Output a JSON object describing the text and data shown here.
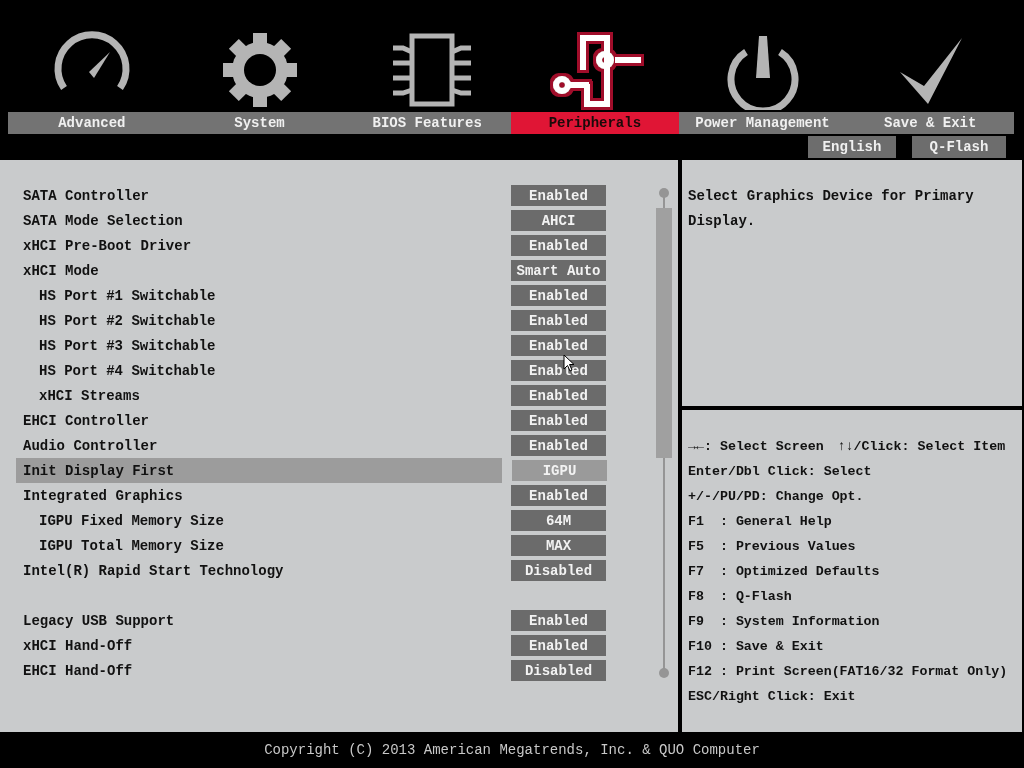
{
  "tabs": [
    {
      "label": "Advanced",
      "selected": false
    },
    {
      "label": "System",
      "selected": false
    },
    {
      "label": "BIOS Features",
      "selected": false
    },
    {
      "label": "Peripherals",
      "selected": true
    },
    {
      "label": "Power Management",
      "selected": false
    },
    {
      "label": "Save & Exit",
      "selected": false
    }
  ],
  "top_buttons": [
    "English",
    "Q-Flash"
  ],
  "settings": [
    {
      "kind": "setting",
      "label": "SATA Controller",
      "value": "Enabled",
      "selected": false
    },
    {
      "kind": "setting",
      "label": "SATA Mode Selection",
      "value": "AHCI",
      "selected": false
    },
    {
      "kind": "setting",
      "label": "xHCI Pre-Boot Driver",
      "value": "Enabled",
      "selected": false
    },
    {
      "kind": "setting",
      "label": "xHCI Mode",
      "value": "Smart Auto",
      "selected": false,
      "children": [
        {
          "kind": "setting",
          "label": "HS Port #1 Switchable",
          "value": "Enabled",
          "selected": false
        },
        {
          "kind": "setting",
          "label": "HS Port #2 Switchable",
          "value": "Enabled",
          "selected": false
        },
        {
          "kind": "setting",
          "label": "HS Port #3 Switchable",
          "value": "Enabled",
          "selected": false
        },
        {
          "kind": "setting",
          "label": "HS Port #4 Switchable",
          "value": "Enabled",
          "selected": false
        },
        {
          "kind": "setting",
          "label": "xHCI Streams",
          "value": "Enabled",
          "selected": false
        }
      ]
    },
    {
      "kind": "setting",
      "label": "EHCI Controller",
      "value": "Enabled",
      "selected": false
    },
    {
      "kind": "setting",
      "label": "Audio Controller",
      "value": "Enabled",
      "selected": false
    },
    {
      "kind": "setting",
      "label": "Init Display First",
      "value": "IGPU",
      "selected": true
    },
    {
      "kind": "setting",
      "label": "Integrated Graphics",
      "value": "Enabled",
      "selected": false,
      "children": [
        {
          "kind": "setting",
          "label": "IGPU Fixed Memory Size",
          "value": "64M",
          "selected": false
        },
        {
          "kind": "setting",
          "label": "IGPU Total Memory Size",
          "value": "MAX",
          "selected": false
        }
      ]
    },
    {
      "kind": "setting",
      "label": "Intel(R) Rapid Start Technology",
      "value": "Disabled",
      "selected": false
    },
    {
      "kind": "spacer"
    },
    {
      "kind": "setting",
      "label": "Legacy USB Support",
      "value": "Enabled",
      "selected": false
    },
    {
      "kind": "setting",
      "label": "xHCI Hand-Off",
      "value": "Enabled",
      "selected": false
    },
    {
      "kind": "setting",
      "label": "EHCI Hand-Off",
      "value": "Disabled",
      "selected": false
    }
  ],
  "help_text": "Select Graphics Device for Primary Display.",
  "key_help": [
    [
      "→←: Select Screen",
      "↑↓/Click: Select Item"
    ],
    [
      "Enter/Dbl Click: Select"
    ],
    [
      "+/-/PU/PD: Change Opt."
    ],
    [
      "F1  : General Help"
    ],
    [
      "F5  : Previous Values"
    ],
    [
      "F7  : Optimized Defaults"
    ],
    [
      "F8  : Q-Flash"
    ],
    [
      "F9  : System Information"
    ],
    [
      "F10 : Save & Exit"
    ],
    [
      "F12 : Print Screen(FAT16/32 Format Only)"
    ],
    [
      "ESC/Right Click: Exit"
    ]
  ],
  "footer": "Copyright (C) 2013 American Megatrends, Inc. & QUO Computer"
}
